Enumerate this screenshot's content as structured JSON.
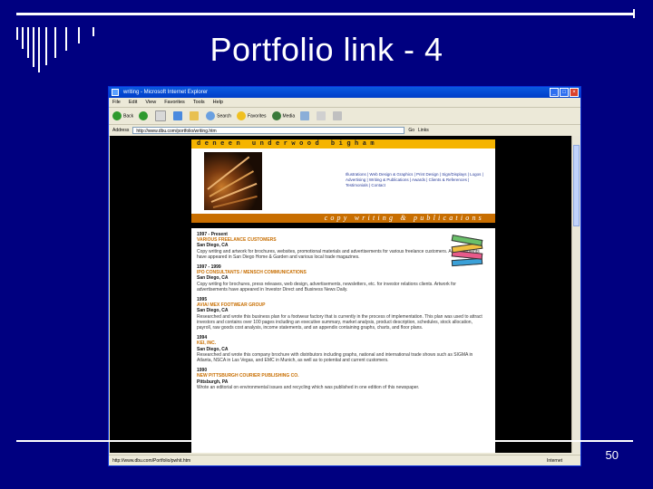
{
  "slide": {
    "title": "Portfolio link - 4",
    "slide_number": "50"
  },
  "browser": {
    "window_title": "writing - Microsoft Internet Explorer",
    "menu": [
      "File",
      "Edit",
      "View",
      "Favorites",
      "Tools",
      "Help"
    ],
    "toolbar": {
      "back": "Back",
      "search": "Search",
      "favorites": "Favorites",
      "media": "Media"
    },
    "address_label": "Address",
    "address": "http://www.dbu.com/portfolio/writing.htm",
    "go": "Go",
    "links_label": "Links",
    "status_text": "http://www.dbu.com/Portfolio/pwhit.htm",
    "status_zone": "Internet"
  },
  "webpage": {
    "brand": "deneen underwood bigham",
    "tagline": "copy writing & publications",
    "nav_text": "Illustrations | Web Design & Graphics | Print Design | Sign/Displays | Logos | Advertising | Writing & Publications | Awards | Clients & References | Testimonials | Contact",
    "entries": [
      {
        "years": "1997 - Present",
        "employer": "VARIOUS FREELANCE CUSTOMERS",
        "location": "San Diego, CA",
        "description": "Copy writing and artwork for brochures, websites, promotional materials and advertisements for various freelance customers. Advertisements have appeared in San Diego Home & Garden and various local trade magazines."
      },
      {
        "years": "1997 - 1999",
        "employer": "IPO CONSULTANTS / MENSCH COMMUNICATIONS",
        "location": "San Diego, CA",
        "description": "Copy writing for brochures, press releases, web design, advertisements, newsletters, etc. for investor relations clients. Artwork for advertisements have appeared in Investor Direct and Business News Daily."
      },
      {
        "years": "1995",
        "employer": "AVIA/ MEX FOOTWEAR GROUP",
        "location": "San Diego, CA",
        "description": "Researched and wrote this business plan for a footwear factory that is currently in the process of implementation. This plan was used to attract investors and contains over 100 pages including an executive summary, market analysis, product description, schedules, stock allocation, payroll, raw goods cost analysis, income statements, and an appendix containing graphs, charts, and floor plans."
      },
      {
        "years": "1994",
        "employer": "KEI, INC.",
        "location": "San Diego, CA",
        "description": "Researched and wrote this company brochure with distributors including graphs, national and international trade shows such as SIGMA in Atlanta, NSCA in Las Vegas, and EMC in Munich, as well as to potential and current customers."
      },
      {
        "years": "1990",
        "employer": "NEW PITTSBURGH COURIER PUBLISHING CO.",
        "location": "Pittsburgh, PA",
        "description": "Wrote an editorial on environmental issues and recycling which was published in one edition of this newspaper."
      }
    ]
  },
  "colors": {
    "slide_bg": "#000080",
    "brand_band": "#f5b400",
    "tagline_band": "#c86e00",
    "employer_text": "#c86e00"
  }
}
